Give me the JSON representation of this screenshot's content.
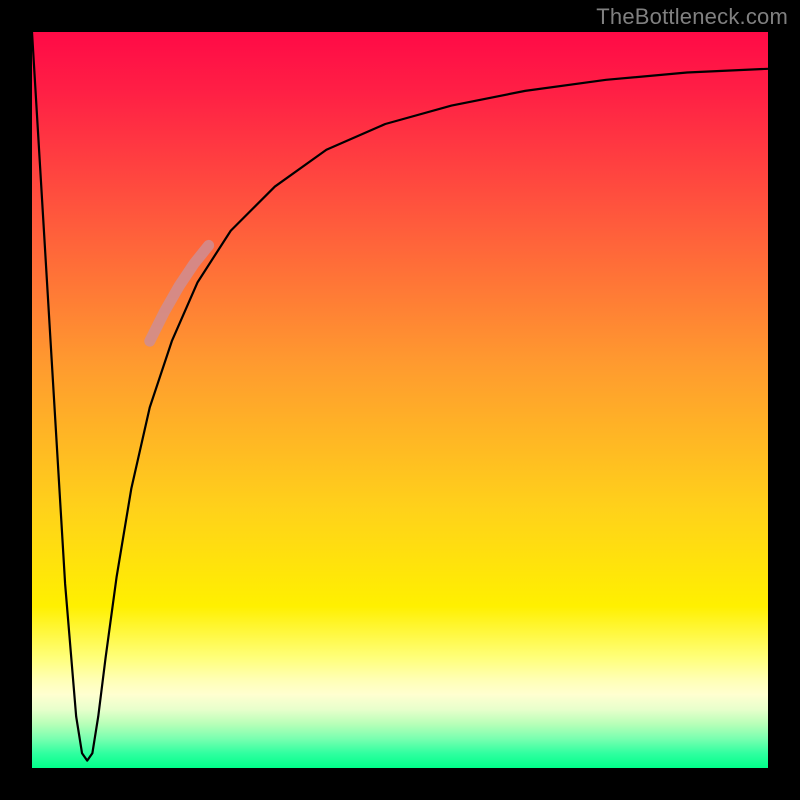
{
  "watermark": "TheBottleneck.com",
  "chart_data": {
    "type": "line",
    "title": "",
    "xlabel": "",
    "ylabel": "",
    "xlim": [
      0,
      100
    ],
    "ylim": [
      0,
      100
    ],
    "gradient_stops": [
      {
        "pos": 0,
        "color": "#ff0a46"
      },
      {
        "pos": 26,
        "color": "#ff5b3c"
      },
      {
        "pos": 45,
        "color": "#ff9a2f"
      },
      {
        "pos": 65,
        "color": "#ffd21a"
      },
      {
        "pos": 78,
        "color": "#fff000"
      },
      {
        "pos": 88,
        "color": "#ffffb5"
      },
      {
        "pos": 94,
        "color": "#b8ffb8"
      },
      {
        "pos": 100,
        "color": "#00ff8a"
      }
    ],
    "series": [
      {
        "name": "bottleneck-curve",
        "stroke": "#000000",
        "stroke_width": 2.2,
        "x": [
          0.0,
          1.5,
          3.0,
          4.5,
          6.0,
          6.8,
          7.5,
          8.2,
          9.0,
          10.0,
          11.5,
          13.5,
          16.0,
          19.0,
          22.5,
          27.0,
          33.0,
          40.0,
          48.0,
          57.0,
          67.0,
          78.0,
          89.0,
          100.0
        ],
        "y": [
          100.0,
          75.0,
          50.0,
          25.0,
          7.0,
          2.0,
          1.0,
          2.0,
          7.0,
          15.0,
          26.0,
          38.0,
          49.0,
          58.0,
          66.0,
          73.0,
          79.0,
          84.0,
          87.5,
          90.0,
          92.0,
          93.5,
          94.5,
          95.0
        ]
      },
      {
        "name": "highlight-segment",
        "stroke": "#cf8d93",
        "stroke_width": 11,
        "linecap": "round",
        "x": [
          16.0,
          18.0,
          20.0,
          22.0,
          24.0
        ],
        "y": [
          58.0,
          62.0,
          65.5,
          68.5,
          71.0
        ]
      }
    ],
    "notch": {
      "x_center": 7.2,
      "depth_y": 1.0
    }
  }
}
